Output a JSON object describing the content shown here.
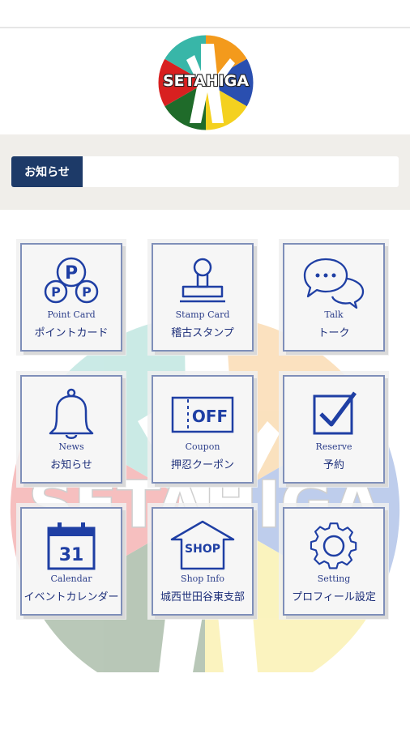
{
  "header": {
    "logo_text": "SETAHIGA"
  },
  "news": {
    "tag_label": "お知らせ"
  },
  "colors": {
    "accent_navy": "#1d3a68",
    "icon_blue": "#1f3fa4",
    "tile_border": "#7f8fb9"
  },
  "menu": [
    {
      "en": "Point Card",
      "jp": "ポイントカード",
      "icon": "point-card-icon"
    },
    {
      "en": "Stamp Card",
      "jp": "稽古スタンプ",
      "icon": "stamp-icon"
    },
    {
      "en": "Talk",
      "jp": "トーク",
      "icon": "chat-bubbles-icon"
    },
    {
      "en": "News",
      "jp": "お知らせ",
      "icon": "bell-icon"
    },
    {
      "en": "Coupon",
      "jp": "押忍クーポン",
      "icon": "coupon-off-icon",
      "icon_text": "OFF"
    },
    {
      "en": "Reserve",
      "jp": "予約",
      "icon": "checkbox-icon"
    },
    {
      "en": "Calendar",
      "jp": "イベントカレンダー",
      "icon": "calendar-icon",
      "icon_text": "31"
    },
    {
      "en": "Shop Info",
      "jp": "城西世田谷東支部",
      "icon": "shop-icon",
      "icon_text": "SHOP"
    },
    {
      "en": "Setting",
      "jp": "プロフィール設定",
      "icon": "gear-icon"
    }
  ]
}
